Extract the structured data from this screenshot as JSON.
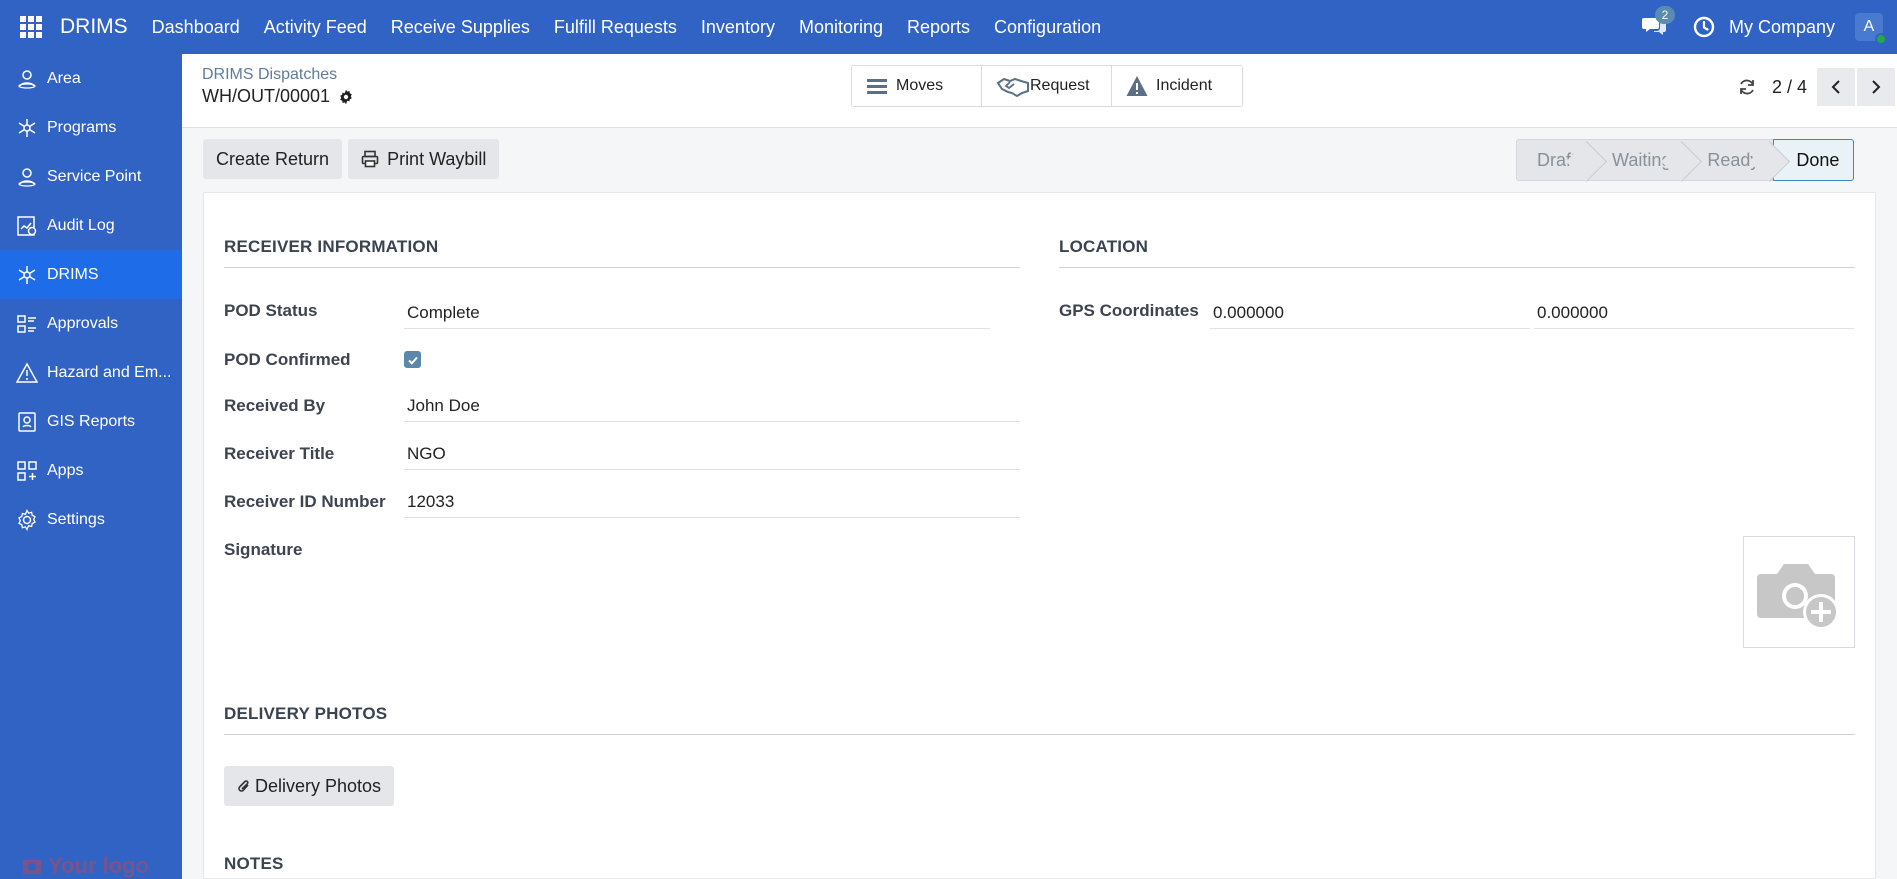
{
  "topbar": {
    "brand": "DRIMS",
    "menu": [
      "Dashboard",
      "Activity Feed",
      "Receive Supplies",
      "Fulfill Requests",
      "Inventory",
      "Monitoring",
      "Reports",
      "Configuration"
    ],
    "chat_count": "2",
    "company": "My Company",
    "avatar_letter": "A"
  },
  "sidebar": {
    "items": [
      {
        "label": "Area",
        "icon": "person-pin-icon"
      },
      {
        "label": "Programs",
        "icon": "hub-icon"
      },
      {
        "label": "Service Point",
        "icon": "person-pin-icon"
      },
      {
        "label": "Audit Log",
        "icon": "audit-chart-icon"
      },
      {
        "label": "DRIMS",
        "icon": "hub-icon"
      },
      {
        "label": "Approvals",
        "icon": "list-grid-icon"
      },
      {
        "label": "Hazard and Em...",
        "icon": "warning-triangle-icon"
      },
      {
        "label": "GIS Reports",
        "icon": "map-report-icon"
      },
      {
        "label": "Apps",
        "icon": "apps-plus-icon"
      },
      {
        "label": "Settings",
        "icon": "gear-icon"
      }
    ],
    "active_index": 4,
    "logo_text": "Your logo"
  },
  "control": {
    "breadcrumb": "DRIMS Dispatches",
    "record_name": "WH/OUT/00001",
    "smart_buttons": [
      {
        "label": "Moves",
        "icon": "hamburger-list-icon"
      },
      {
        "label": "Request",
        "icon": "handshake-icon"
      },
      {
        "label": "Incident",
        "icon": "warning-triangle-icon"
      }
    ],
    "pager": "2 / 4"
  },
  "actions": {
    "create_return": "Create Return",
    "print_waybill": "Print Waybill"
  },
  "statusbar": {
    "stages": [
      "Draft",
      "Waiting",
      "Ready",
      "Done"
    ],
    "current": "Done"
  },
  "receiver": {
    "title": "RECEIVER INFORMATION",
    "pod_status_label": "POD Status",
    "pod_status_value": "Complete",
    "pod_confirmed_label": "POD Confirmed",
    "pod_confirmed": true,
    "received_by_label": "Received By",
    "received_by_value": "John Doe",
    "receiver_title_label": "Receiver Title",
    "receiver_title_value": "NGO",
    "receiver_id_label": "Receiver ID Number",
    "receiver_id_value": "12033",
    "signature_label": "Signature"
  },
  "location": {
    "title": "LOCATION",
    "gps_label": "GPS Coordinates",
    "latitude": "0.000000",
    "longitude": "0.000000"
  },
  "delivery": {
    "title": "DELIVERY PHOTOS",
    "button": "Delivery Photos"
  },
  "notes": {
    "title": "NOTES"
  }
}
